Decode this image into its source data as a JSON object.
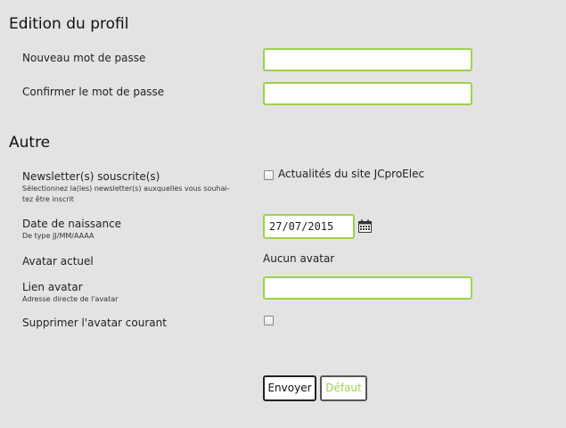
{
  "sections": {
    "profile_title": "Edition du profil",
    "other_title": "Autre"
  },
  "fields": {
    "new_password": {
      "label": "Nouveau mot de passe",
      "value": ""
    },
    "confirm_password": {
      "label": "Confirmer le mot de passe",
      "value": ""
    },
    "newsletter": {
      "label": "Newsletter(s) souscrite(s)",
      "hint_line1": "Sélectionnez la(les) newsletter(s) auxquelles vous souhai-",
      "hint_line2": "tez être inscrit",
      "option_label": "Actualités du site JCproElec",
      "checked": false
    },
    "birthdate": {
      "label": "Date de naissance",
      "hint": "De type JJ/MM/AAAA",
      "value": "27/07/2015",
      "icon": "calendar-icon"
    },
    "current_avatar": {
      "label": "Avatar actuel",
      "value": "Aucun avatar"
    },
    "avatar_link": {
      "label": "Lien avatar",
      "hint": "Adresse directe de l'avatar",
      "value": ""
    },
    "delete_avatar": {
      "label": "Supprimer l'avatar courant",
      "checked": false
    }
  },
  "buttons": {
    "submit": "Envoyer",
    "reset": "Défaut"
  },
  "colors": {
    "accent": "#9ed04d",
    "background": "#e3e3e3"
  }
}
